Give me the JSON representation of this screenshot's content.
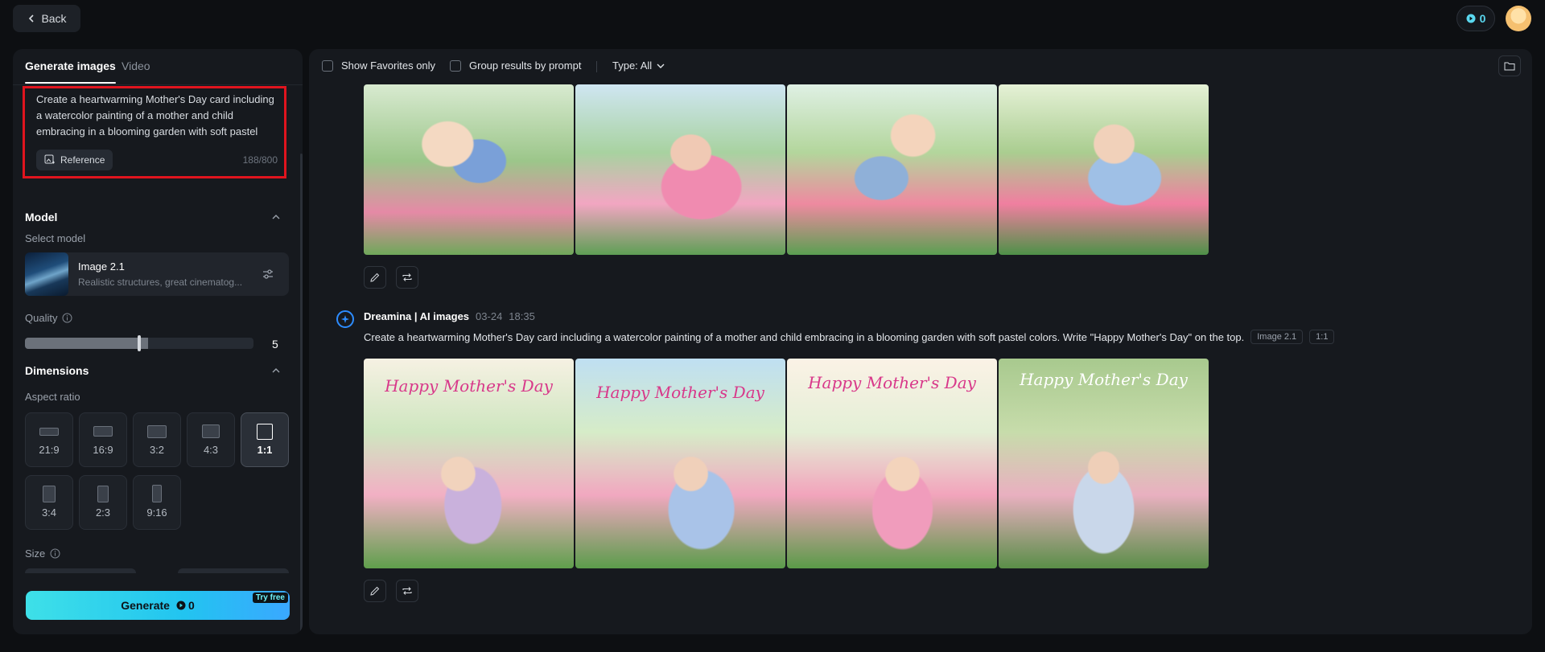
{
  "topbar": {
    "back_label": "Back",
    "credits": "0"
  },
  "left_panel": {
    "tabs": [
      {
        "label": "Generate images"
      },
      {
        "label": "Video"
      }
    ],
    "prompt": {
      "text": "Create a heartwarming Mother's Day card including a watercolor painting of a mother and child embracing in a blooming garden with soft pastel colors. Write \"Happy Mother's Day\" on the top.",
      "reference_label": "Reference",
      "char_count": "188/800"
    },
    "model": {
      "section_title": "Model",
      "select_label": "Select model",
      "name": "Image 2.1",
      "description": "Realistic structures, great cinematog..."
    },
    "quality": {
      "label": "Quality",
      "value": "5",
      "fill_fraction": 0.54
    },
    "dimensions": {
      "section_title": "Dimensions",
      "aspect_label": "Aspect ratio",
      "ratios": [
        "21:9",
        "16:9",
        "3:2",
        "4:3",
        "1:1",
        "3:4",
        "2:3",
        "9:16"
      ],
      "selected": "1:1"
    },
    "size_label": "Size",
    "generate": {
      "label": "Generate",
      "credits": "0",
      "badge": "Try free"
    }
  },
  "right_panel": {
    "filters": {
      "favorites_label": "Show Favorites only",
      "group_label": "Group results by prompt",
      "type_label": "Type: All"
    },
    "generation": {
      "author": "Dreamina | AI images",
      "date": "03-24",
      "time": "18:35",
      "prompt": "Create a heartwarming Mother's Day card including a watercolor painting of a mother and child embracing in a blooming garden with soft pastel colors. Write \"Happy Mother's Day\" on the top.",
      "model_tag": "Image 2.1",
      "ratio_tag": "1:1",
      "titles": [
        "Happy Mother's Day",
        "Happy Mother's Day",
        "Happy Mother's Day",
        "Happy Mother's Day"
      ]
    }
  },
  "colors": {
    "accent": "#22c4f0",
    "highlight_box": "#e0141e",
    "panel": "#16191e"
  }
}
